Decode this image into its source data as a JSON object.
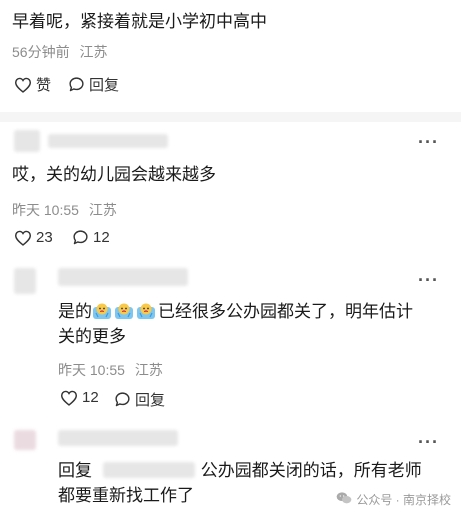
{
  "comment1": {
    "text": "早着呢，紧接着就是小学初中高中",
    "time": "56分钟前",
    "location": "江苏",
    "like_label": "赞",
    "reply_label": "回复"
  },
  "comment2": {
    "text": "哎，关的幼儿园会越来越多",
    "time": "昨天 10:55",
    "location": "江苏",
    "like_count": "23",
    "reply_count": "12",
    "more": "···"
  },
  "comment3": {
    "text_tail": "已经很多公办园都关了，明年估计",
    "text_prefix": "是的",
    "text_line2": "关的更多",
    "emoji_icons": [
      "crying-face-icon",
      "crying-face-icon",
      "crying-face-icon"
    ],
    "time": "昨天 10:55",
    "location": "江苏",
    "like_count": "12",
    "reply_label": "回复",
    "more": "···"
  },
  "comment4": {
    "reply_prefix": "回复",
    "text_tail": "公办园都关闭的话，所有老师",
    "text_line2": "都要重新找工作了",
    "more": "···"
  },
  "watermark": {
    "text": "公众号 · 南京择校",
    "icon": "wechat-icon"
  },
  "colors": {
    "text": "#1a1a1a",
    "meta": "#8c8c8c",
    "divider": "#f5f5f5"
  }
}
